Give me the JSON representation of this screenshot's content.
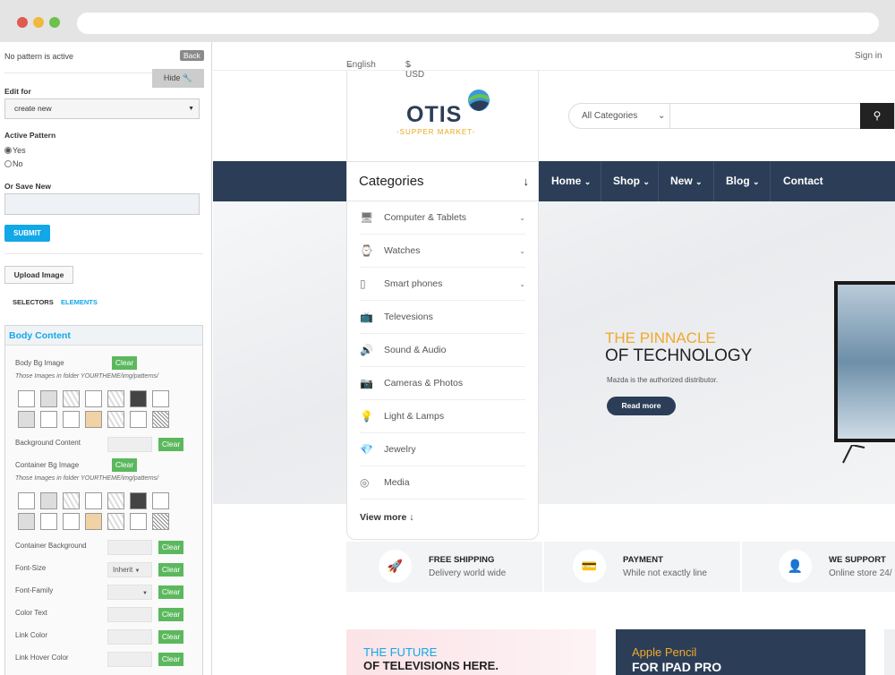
{
  "panel": {
    "status": "No pattern is active",
    "back": "Back",
    "hide": "Hide",
    "edit_for_label": "Edit for",
    "edit_for_value": "create new",
    "active_pattern_label": "Active Pattern",
    "yes": "Yes",
    "no": "No",
    "save_new_label": "Or Save New",
    "submit": "SUBMIT",
    "upload": "Upload Image",
    "tab_selectors": "SELECTORS",
    "tab_elements": "ELEMENTS",
    "body_content": "Body Content",
    "body_bg_image": "Body Bg Image",
    "images_note": "Those Images in folder YOURTHEME/img/patterns/",
    "background_content": "Background Content",
    "container_bg_image": "Container Bg Image",
    "container_background": "Container Background",
    "font_size": "Font-Size",
    "font_size_value": "Inherit",
    "font_family": "Font-Family",
    "color_text": "Color Text",
    "link_color": "Link Color",
    "link_hover_color": "Link Hover Color",
    "clear": "Clear"
  },
  "topbar": {
    "language": "English",
    "currency": "$ USD",
    "signin": "Sign in"
  },
  "logo": {
    "name": "OTIS",
    "tagline": "-SUPPER MARKET-"
  },
  "search": {
    "category": "All Categories",
    "button_icon": "search-icon"
  },
  "nav": {
    "home": "Home",
    "shop": "Shop",
    "new": "New",
    "blog": "Blog",
    "contact": "Contact"
  },
  "categories": {
    "title": "Categories",
    "items": [
      {
        "label": "Computer & Tablets",
        "icon": "monitor-icon"
      },
      {
        "label": "Watches",
        "icon": "watch-icon"
      },
      {
        "label": "Smart phones",
        "icon": "phone-icon"
      },
      {
        "label": "Televesions",
        "icon": "tv-icon"
      },
      {
        "label": "Sound & Audio",
        "icon": "audio-icon"
      },
      {
        "label": "Cameras & Photos",
        "icon": "camera-icon"
      },
      {
        "label": "Light & Lamps",
        "icon": "bulb-icon"
      },
      {
        "label": "Jewelry",
        "icon": "diamond-icon"
      },
      {
        "label": "Media",
        "icon": "media-icon"
      }
    ],
    "view_more": "View more"
  },
  "hero": {
    "line1": "THE PINNACLE",
    "line2": "OF TECHNOLOGY",
    "sub": "Mazda is the authorized distributor.",
    "cta": "Read more"
  },
  "features": [
    {
      "title": "FREE SHIPPING",
      "text": "Delivery world wide"
    },
    {
      "title": "PAYMENT",
      "text": "While not exactly line"
    },
    {
      "title": "WE SUPPORT",
      "text": "Online store 24/"
    }
  ],
  "promos": [
    {
      "line1": "THE FUTURE",
      "line2": "OF TELEVISIONS HERE."
    },
    {
      "line1": "Apple Pencil",
      "line2": "FOR IPAD PRO"
    }
  ],
  "colors": {
    "nav": "#2c3e57",
    "accent": "#f0a92a",
    "link": "#12a8e8",
    "clear": "#5bb85d"
  }
}
